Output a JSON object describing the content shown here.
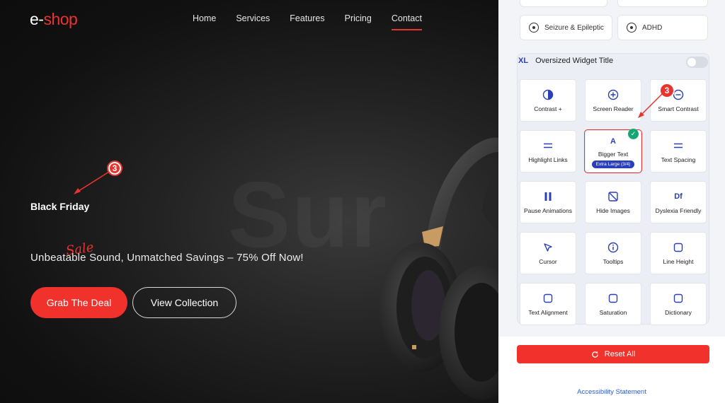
{
  "site": {
    "logo_e": "e",
    "logo_dash": "-",
    "logo_shop": "shop",
    "nav": [
      "Home",
      "Services",
      "Features",
      "Pricing",
      "Contact"
    ],
    "active_nav": "Contact"
  },
  "hero": {
    "background_word": "Sur",
    "headline": "Black Friday",
    "script_word": "Sale",
    "tagline": "Unbeatable Sound, Unmatched Savings – 75% Off Now!",
    "primary_button": "Grab The Deal",
    "secondary_button": "View Collection",
    "callout_number": "3"
  },
  "panel": {
    "top_cards": [
      {
        "label": "Seizure & Epileptic",
        "icon": "target-icon"
      },
      {
        "label": "ADHD",
        "icon": "target-icon"
      }
    ],
    "widget_size_tag": "XL",
    "widget_title": "Oversized Widget Title",
    "callout_number": "3",
    "tiles": [
      {
        "label": "Contrast +",
        "icon": "contrast-icon"
      },
      {
        "label": "Screen Reader",
        "icon": "plus-circle-icon"
      },
      {
        "label": "Smart Contrast",
        "icon": "contrast-minus-icon"
      },
      {
        "label": "Highlight Links",
        "icon": "equals-icon"
      },
      {
        "label": "Bigger Text",
        "icon": "letter-a-icon",
        "level": "Extra Large (3/4)",
        "selected": true
      },
      {
        "label": "Text Spacing",
        "icon": "equals-icon"
      },
      {
        "label": "Pause Animations",
        "icon": "pause-icon"
      },
      {
        "label": "Hide Images",
        "icon": "hide-image-icon"
      },
      {
        "label": "Dyslexia Friendly",
        "icon": "df-icon",
        "icon_text": "Df"
      },
      {
        "label": "Cursor",
        "icon": "cursor-icon"
      },
      {
        "label": "Tooltips",
        "icon": "info-icon"
      },
      {
        "label": "Line Height",
        "icon": "square-icon"
      },
      {
        "label": "Text Alignment",
        "icon": "square-icon"
      },
      {
        "label": "Saturation",
        "icon": "square-icon"
      },
      {
        "label": "Dictionary",
        "icon": "square-icon"
      }
    ],
    "reset_label": "Reset All",
    "statement_link": "Accessibility Statement"
  },
  "colors": {
    "accent_red": "#f1312c",
    "accent_blue": "#2a3fb8",
    "success_green": "#17a673"
  }
}
